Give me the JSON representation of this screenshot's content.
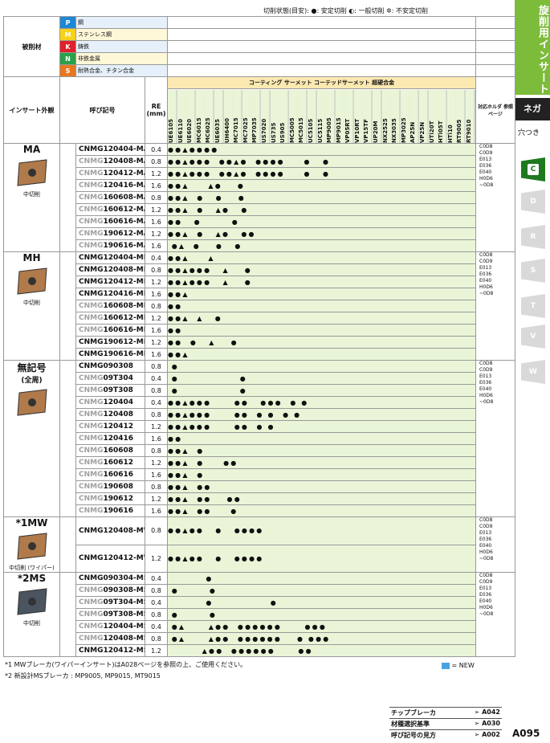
{
  "legend": "切削状態(目安):  ●: 安定切削  ◐: 一般切削  ✲: 不安定切削",
  "side": {
    "title": "旋削用インサート",
    "nega": "ネガ",
    "hole": "穴つき",
    "tabs": [
      "C",
      "D",
      "R",
      "S",
      "T",
      "V",
      "W"
    ]
  },
  "materials": {
    "label": "被削材",
    "rows": [
      {
        "letter": "P",
        "name": "鋼",
        "color": "#1e88d2"
      },
      {
        "letter": "M",
        "name": "ステンレス鋼",
        "color": "#f6d21a"
      },
      {
        "letter": "K",
        "name": "鋳鉄",
        "color": "#e0202a"
      },
      {
        "letter": "N",
        "name": "非鉄金属",
        "color": "#2aa14a"
      },
      {
        "letter": "S",
        "name": "耐熱合金、チタン合金",
        "color": "#e87820"
      }
    ]
  },
  "headers": {
    "insert_shape": "インサート外観",
    "code": "呼び記号",
    "re": "RE",
    "re_unit": "(mm)",
    "coating": "コーティング",
    "cermet": "サーメット",
    "coated_cermet": "コーテッドサーメット",
    "carbide": "超硬合金",
    "holder": "対応ホルダ 参照ページ"
  },
  "grades": [
    "UE6105",
    "UE6110",
    "UE6020",
    "MC6015",
    "MC6025",
    "UE6035",
    "UH6400",
    "MC7015",
    "MC7025",
    "MP7035",
    "US7020",
    "US735",
    "US905",
    "MC5005",
    "MC5015",
    "UC5105",
    "UC5115",
    "MP9005",
    "MP9015",
    "VP05RT",
    "VP10RT",
    "VP15TF",
    "UP20M",
    "NX2525",
    "NX3035",
    "MP3025",
    "AP25N",
    "VP25N",
    "UTi20T",
    "HTi05T",
    "HTi10",
    "RT9005",
    "RT9010"
  ],
  "groups": [
    {
      "shape": "MA",
      "shape_note": "中切削",
      "rows": [
        {
          "pre": "",
          "dim": "",
          "code": "CNMG120404-MA",
          "re": "0.4",
          "marks": "●●▲●●●●"
        },
        {
          "pre": "CNMG",
          "dim": "",
          "code": "120408-MA",
          "re": "0.8",
          "marks": "●●▲●●●  ●●▲●  ●●●●     ●   ●"
        },
        {
          "pre": "CNMG",
          "dim": "",
          "code": "120412-MA",
          "re": "1.2",
          "marks": "●●▲●●●  ●●▲●  ●●●●     ●   ●"
        },
        {
          "pre": "CNMG",
          "dim": "",
          "code": "120416-MA",
          "re": "1.6",
          "marks": "●●▲     ▲●    ●"
        },
        {
          "pre": "CNMG",
          "dim": "",
          "code": "160608-MA",
          "re": "0.8",
          "marks": "●●▲  ●   ●    ●"
        },
        {
          "pre": "CNMG",
          "dim": "",
          "code": "160612-MA",
          "re": "1.2",
          "marks": "●●▲  ●   ▲●   ●"
        },
        {
          "pre": "CNMG",
          "dim": "",
          "code": "160616-MA",
          "re": "1.6",
          "marks": "●●   ●        ●"
        },
        {
          "pre": "CNMG",
          "dim": "",
          "code": "190612-MA",
          "re": "1.2",
          "marks": "●●▲  ●   ▲●   ●●"
        },
        {
          "pre": "CNMG",
          "dim": "",
          "code": "190616-MA",
          "re": "1.6",
          "marks": " ●▲  ●    ●   ●"
        }
      ],
      "holders": [
        "C0D8",
        "C0D9",
        "E013",
        "E036",
        "E040",
        "H0D6",
        "~0D8"
      ]
    },
    {
      "shape": "MH",
      "shape_note": "中切削",
      "rows": [
        {
          "pre": "",
          "dim": "",
          "code": "CNMG120404-MH",
          "re": "0.4",
          "marks": "●●▲     ▲"
        },
        {
          "pre": "",
          "dim": "",
          "code": "CNMG120408-MH",
          "re": "0.8",
          "marks": "●●▲●●●   ▲    ●"
        },
        {
          "pre": "",
          "dim": "",
          "code": "CNMG120412-MH",
          "re": "1.2",
          "marks": "●●▲●●●   ▲    ●"
        },
        {
          "pre": "",
          "dim": "",
          "code": "CNMG120416-MH",
          "re": "1.6",
          "marks": "●●▲"
        },
        {
          "pre": "CNMG",
          "dim": "",
          "code": "160608-MH",
          "re": "0.8",
          "marks": "●●"
        },
        {
          "pre": "CNMG",
          "dim": "",
          "code": "160612-MH",
          "re": "1.2",
          "marks": "●●▲  ▲   ●"
        },
        {
          "pre": "CNMG",
          "dim": "",
          "code": "160616-MH",
          "re": "1.6",
          "marks": "●●"
        },
        {
          "pre": "",
          "dim": "",
          "code": "CNMG190612-MH",
          "re": "1.2",
          "marks": "●●  ●   ▲    ●"
        },
        {
          "pre": "",
          "dim": "",
          "code": "CNMG190616-MH",
          "re": "1.6",
          "marks": "●●▲"
        }
      ],
      "holders": [
        "C0D8",
        "C0D9",
        "E013",
        "E036",
        "E040",
        "H0D6",
        "~0D8"
      ]
    },
    {
      "shape": "無記号",
      "shape2": "(全周)",
      "rows": [
        {
          "pre": "",
          "dim": "",
          "code": "CNMG090308",
          "re": "0.8",
          "marks": " ●"
        },
        {
          "pre": "CNMG",
          "dim": "",
          "code": "09T304",
          "re": "0.4",
          "marks": " ●                ●"
        },
        {
          "pre": "CNMG",
          "dim": "",
          "code": "09T308",
          "re": "0.8",
          "marks": " ●                ●"
        },
        {
          "pre": "CNMG",
          "dim": "",
          "code": "120404",
          "re": "0.4",
          "marks": "●●▲●●●      ●●   ●●●  ● ●"
        },
        {
          "pre": "CNMG",
          "dim": "",
          "code": "120408",
          "re": "0.8",
          "marks": "●●▲●●●      ●●  ● ●  ● ●"
        },
        {
          "pre": "CNMG",
          "dim": "",
          "code": "120412",
          "re": "1.2",
          "marks": "●●▲●●●      ●●  ● ●"
        },
        {
          "pre": "CNMG",
          "dim": "",
          "code": "120416",
          "re": "1.6",
          "marks": "●●"
        },
        {
          "pre": "CNMG",
          "dim": "",
          "code": "160608",
          "re": "0.8",
          "marks": "●●▲  ●"
        },
        {
          "pre": "CNMG",
          "dim": "",
          "code": "160612",
          "re": "1.2",
          "marks": "●●▲  ●     ●●"
        },
        {
          "pre": "CNMG",
          "dim": "",
          "code": "160616",
          "re": "1.6",
          "marks": "●●▲  ●"
        },
        {
          "pre": "CNMG",
          "dim": "",
          "code": "190608",
          "re": "0.8",
          "marks": "●●▲  ●●"
        },
        {
          "pre": "CNMG",
          "dim": "",
          "code": "190612",
          "re": "1.2",
          "marks": "●●▲  ●●    ●●"
        },
        {
          "pre": "CNMG",
          "dim": "",
          "code": "190616",
          "re": "1.6",
          "marks": "●●▲  ●●     ●"
        }
      ],
      "holders": [
        "C0D8",
        "C0D9",
        "E013",
        "E036",
        "E040",
        "H0D6",
        "~0D8"
      ]
    },
    {
      "shape": "*1MW",
      "shape_note": "中切削 (ワイパー)",
      "rows": [
        {
          "pre": "",
          "dim": "",
          "code": "CNMG120408-MW",
          "re": "0.8",
          "marks": "●●▲●●   ●   ●●●●"
        },
        {
          "pre": "",
          "dim": "",
          "code": "CNMG120412-MW",
          "re": "1.2",
          "marks": "●●▲●●   ●   ●●●●"
        }
      ],
      "holders": [
        "C0D8",
        "C0D9",
        "E013",
        "E036",
        "E040",
        "H0D6",
        "~0D8"
      ]
    },
    {
      "shape": "*2MS",
      "shape_note": "中切削",
      "rows": [
        {
          "pre": "",
          "dim": "",
          "code": "CNMG090304-MS",
          "re": "0.4",
          "marks": "          ●"
        },
        {
          "pre": "CNMG",
          "dim": "",
          "code": "090308-MS",
          "re": "0.8",
          "marks": " ●        ●"
        },
        {
          "pre": "CNMG",
          "dim": "",
          "code": "09T304-MS",
          "re": "0.4",
          "marks": "          ●               ●"
        },
        {
          "pre": "CNMG",
          "dim": "",
          "code": "09T308-MS",
          "re": "0.8",
          "marks": " ●        ●"
        },
        {
          "pre": "CNMG",
          "dim": "",
          "code": "120404-MS",
          "re": "0.4",
          "marks": " ●▲      ▲●●  ●●●●●●      ●●●"
        },
        {
          "pre": "CNMG",
          "dim": "",
          "code": "120408-MS",
          "re": "0.8",
          "marks": " ●▲      ▲●●  ●●●●●●    ● ●●●"
        },
        {
          "pre": "",
          "dim": "",
          "code": "CNMG120412-MS",
          "re": "1.2",
          "marks": "         ▲●●  ●●●●●●      ●●"
        }
      ],
      "holders": [
        "C0D8",
        "C0D9",
        "E013",
        "E036",
        "E040",
        "H0D6",
        "~0D8"
      ]
    }
  ],
  "footnotes": {
    "f1": "*1 MWブレーカ(ワイパーインサート)はA028ページを参照の上、ご使用ください。",
    "f2": "*2 新設計MSブレーカ : MP9005, MP9015, MT9015",
    "new_mark": "= NEW"
  },
  "refs": [
    {
      "label": "チップブレーカ",
      "page": "➢ A042"
    },
    {
      "label": "材種選択基準",
      "page": "➢ A030"
    },
    {
      "label": "呼び記号の見方",
      "page": "➢ A002"
    }
  ],
  "page_number": "A095"
}
